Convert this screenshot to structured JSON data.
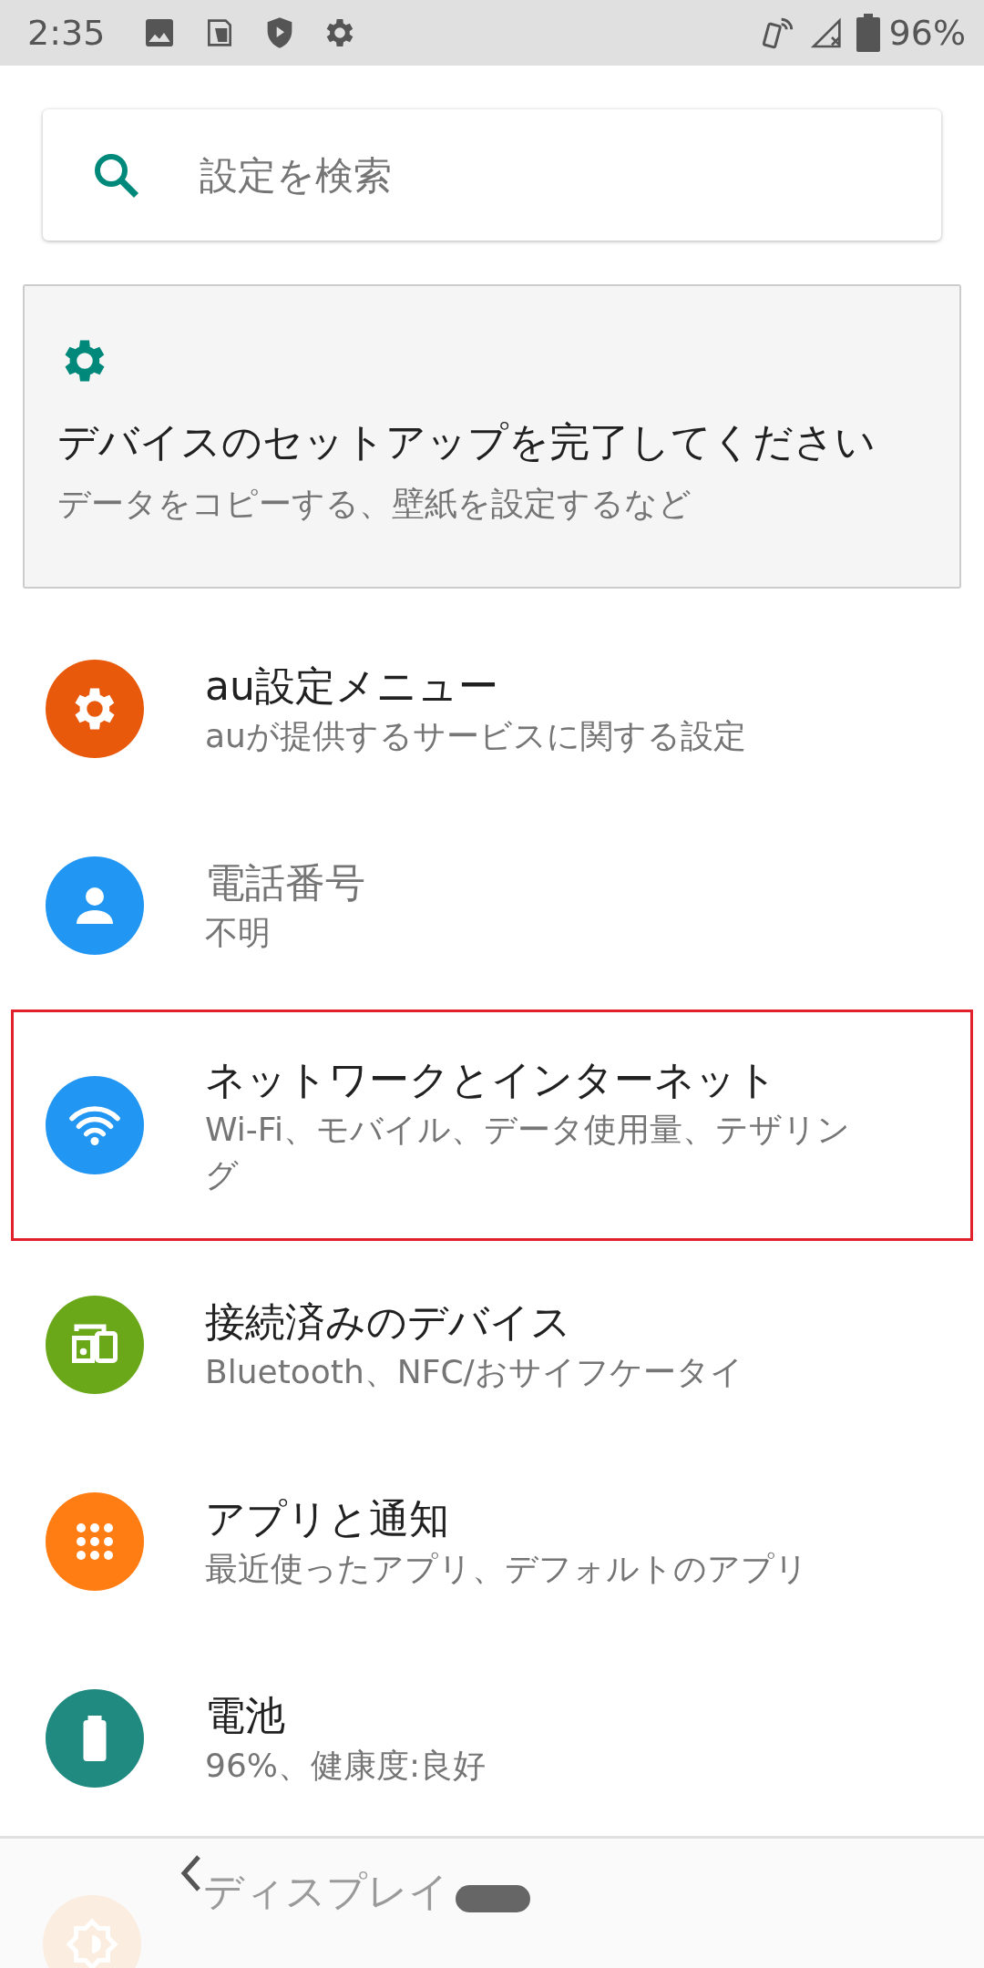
{
  "status_bar": {
    "time": "2:35",
    "battery": "96%"
  },
  "search": {
    "placeholder": "設定を検索"
  },
  "setup_card": {
    "title": "デバイスのセットアップを完了してください",
    "subtitle": "データをコピーする、壁紙を設定するなど"
  },
  "items": [
    {
      "kind": "gear",
      "color": "#e8590c",
      "title": "au設定メニュー",
      "subtitle": "auが提供するサービスに関する設定",
      "disabled": false,
      "highlighted": false
    },
    {
      "kind": "person",
      "color": "#2196f3",
      "title": "電話番号",
      "subtitle": "不明",
      "disabled": true,
      "highlighted": false
    },
    {
      "kind": "wifi",
      "color": "#2196f3",
      "title": "ネットワークとインターネット",
      "subtitle": "Wi-Fi、モバイル、データ使用量、テザリング",
      "disabled": false,
      "highlighted": true
    },
    {
      "kind": "devices",
      "color": "#6aa819",
      "title": "接続済みのデバイス",
      "subtitle": "Bluetooth、NFC/おサイフケータイ",
      "disabled": false,
      "highlighted": false
    },
    {
      "kind": "apps",
      "color": "#ff7d12",
      "title": "アプリと通知",
      "subtitle": "最近使ったアプリ、デフォルトのアプリ",
      "disabled": false,
      "highlighted": false
    },
    {
      "kind": "battery",
      "color": "#218a80",
      "title": "電池",
      "subtitle": "96%、健康度:良好",
      "disabled": false,
      "highlighted": false
    }
  ],
  "peek_item": {
    "kind": "display",
    "color": "#fbeee0",
    "title": "ディスプレイ"
  }
}
